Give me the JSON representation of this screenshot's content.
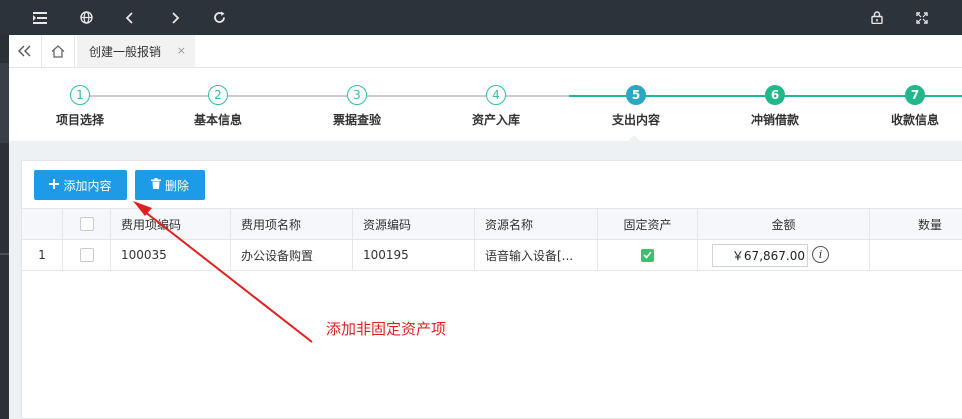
{
  "topbar": {
    "icons": [
      "menu-icon",
      "globe-icon",
      "chevron-left-icon",
      "chevron-right-icon",
      "refresh-icon",
      "lock-icon",
      "fullscreen-icon"
    ]
  },
  "tabbar": {
    "tab_label": "创建一般报销",
    "close_glyph": "×"
  },
  "steps": [
    {
      "num": "1",
      "label": "项目选择",
      "state": "done"
    },
    {
      "num": "2",
      "label": "基本信息",
      "state": "done"
    },
    {
      "num": "3",
      "label": "票据查验",
      "state": "done"
    },
    {
      "num": "4",
      "label": "资产入库",
      "state": "done"
    },
    {
      "num": "5",
      "label": "支出内容",
      "state": "active"
    },
    {
      "num": "6",
      "label": "冲销借款",
      "state": "todo"
    },
    {
      "num": "7",
      "label": "收款信息",
      "state": "todo"
    }
  ],
  "toolbar": {
    "add_label": "添加内容",
    "delete_label": "删除"
  },
  "table": {
    "columns": [
      "费用项编码",
      "费用项名称",
      "资源编码",
      "资源名称",
      "固定资产",
      "金额",
      "数量"
    ],
    "rows": [
      {
        "index": "1",
        "fee_code": "100035",
        "fee_name": "办公设备购置",
        "res_code": "100195",
        "res_name": "语音输入设备[...",
        "fixed_asset": true,
        "amount": "￥67,867.00",
        "quantity": ""
      }
    ]
  },
  "annotation": {
    "text": "添加非固定资产项",
    "color": "#e02020"
  },
  "colors": {
    "primary_button": "#1e9be6",
    "step_done": "#2fbfa0",
    "step_active": "#2aa7c2",
    "step_todo": "#1fb88a",
    "topbar": "#2d333b"
  }
}
